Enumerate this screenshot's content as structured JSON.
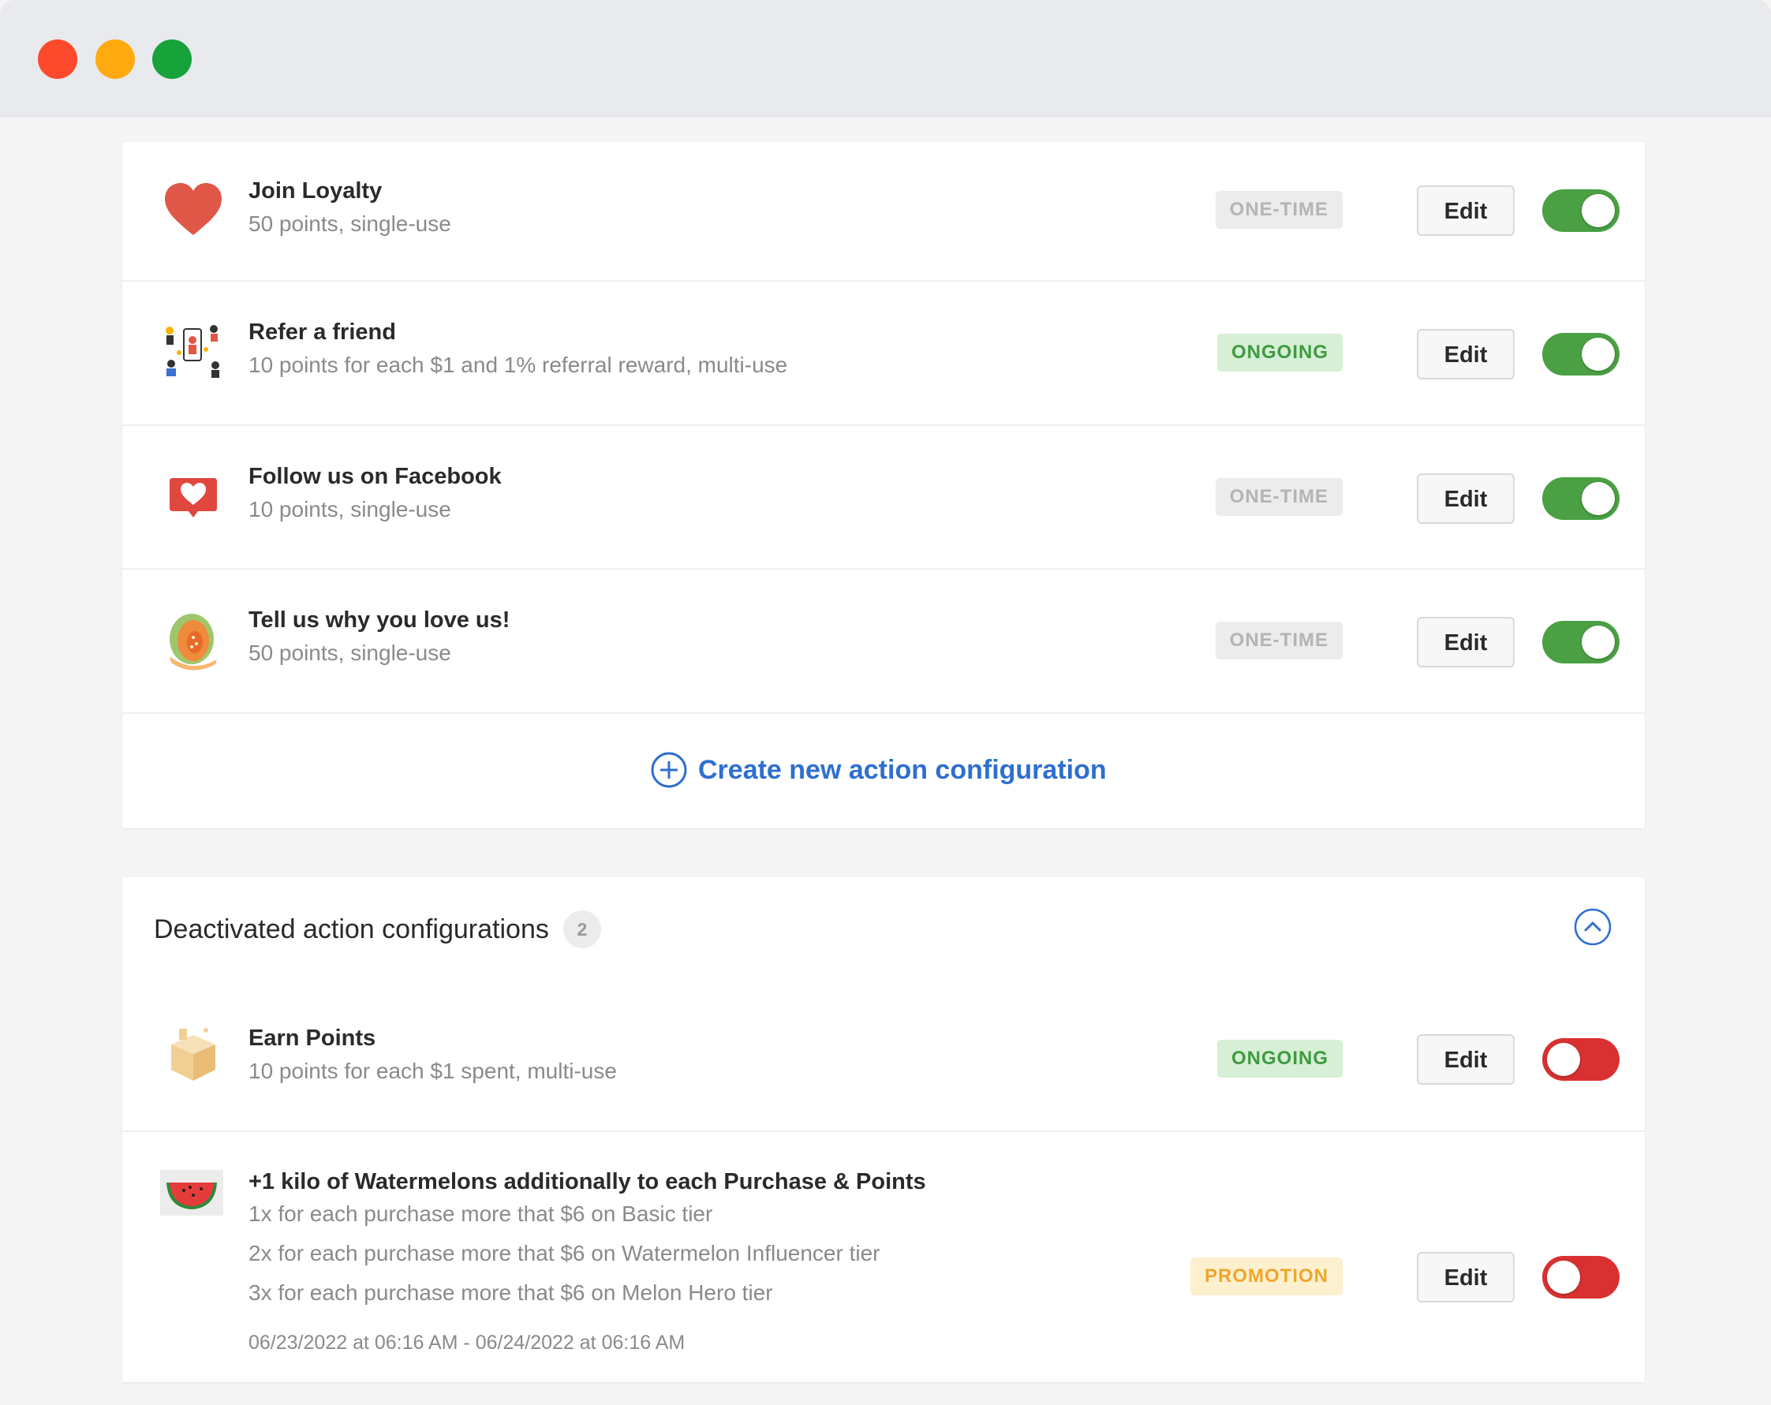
{
  "active_actions": [
    {
      "title": "Join Loyalty",
      "subtitle": "50 points, single-use",
      "badge": "ONE-TIME",
      "edit": "Edit",
      "enabled": true,
      "icon": "heart-icon"
    },
    {
      "title": "Refer a friend",
      "subtitle": "10 points for each $1 and 1% referral reward, multi-use",
      "badge": "ONGOING",
      "edit": "Edit",
      "enabled": true,
      "icon": "referral-illustration-icon"
    },
    {
      "title": "Follow us on Facebook",
      "subtitle": "10 points, single-use",
      "badge": "ONE-TIME",
      "edit": "Edit",
      "enabled": true,
      "icon": "heart-message-icon"
    },
    {
      "title": "Tell us why you love us!",
      "subtitle": "50 points, single-use",
      "badge": "ONE-TIME",
      "edit": "Edit",
      "enabled": true,
      "icon": "melon-icon"
    }
  ],
  "create_action_label": "Create new action configuration",
  "deactivated": {
    "title": "Deactivated action configurations",
    "count": "2",
    "items": [
      {
        "title": "Earn Points",
        "subtitle": "10 points for each $1 spent, multi-use",
        "badge": "ONGOING",
        "edit": "Edit",
        "enabled": false,
        "icon": "box-icon"
      },
      {
        "title": "+1 kilo of Watermelons additionally to each Purchase & Points",
        "lines": [
          "1x for each purchase more that $6 on Basic tier",
          "2x for each purchase more that $6 on Watermelon Influencer tier",
          "3x for each purchase more that $6 on Melon Hero tier"
        ],
        "date_range": "06/23/2022 at 06:16 AM - 06/24/2022 at 06:16 AM",
        "badge": "PROMOTION",
        "edit": "Edit",
        "enabled": false,
        "icon": "watermelon-icon"
      }
    ]
  },
  "colors": {
    "toggle_on": "#4aa043",
    "toggle_off": "#d93131",
    "link": "#2e6fcf"
  }
}
